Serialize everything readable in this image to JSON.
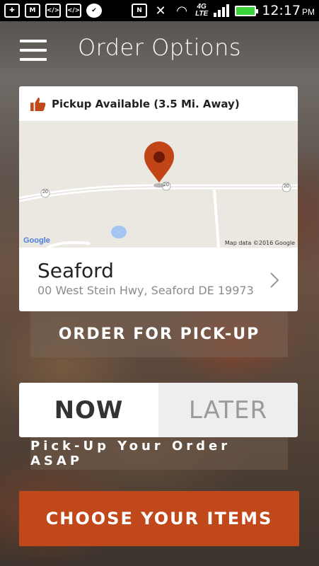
{
  "status_bar": {
    "time": "12:17",
    "ampm": "PM",
    "network": "4G LTE",
    "icons": [
      "add-icon",
      "gmail-icon",
      "code-icon",
      "code-icon",
      "check-icon",
      "nfc-icon",
      "mute-icon",
      "wifi-icon",
      "signal-icon",
      "battery-icon"
    ]
  },
  "header": {
    "title": "Order Options",
    "menu_icon": "hamburger-menu-icon"
  },
  "location_card": {
    "availability": "Pickup Available (3.5 Mi. Away)",
    "availability_icon": "thumbs-up-icon",
    "map": {
      "logo": "Google",
      "credit": "Map data ©2016 Google",
      "road_labels": [
        "20",
        "20",
        "20"
      ],
      "pin_icon": "map-pin-icon"
    },
    "store_name": "Seaford",
    "address": "00 West Stein Hwy, Seaford DE 19973",
    "chevron_icon": "chevron-right-icon"
  },
  "order_pickup_label": "ORDER FOR PICK-UP",
  "timing_toggle": {
    "now_label": "NOW",
    "later_label": "LATER",
    "selected": "NOW"
  },
  "asap_label": "Pick-Up Your Order ASAP",
  "choose_items_label": "CHOOSE YOUR ITEMS",
  "colors": {
    "accent": "#c0481b",
    "pin": "#c24518",
    "thumb": "#c0481b",
    "battery": "#3ad13a"
  }
}
